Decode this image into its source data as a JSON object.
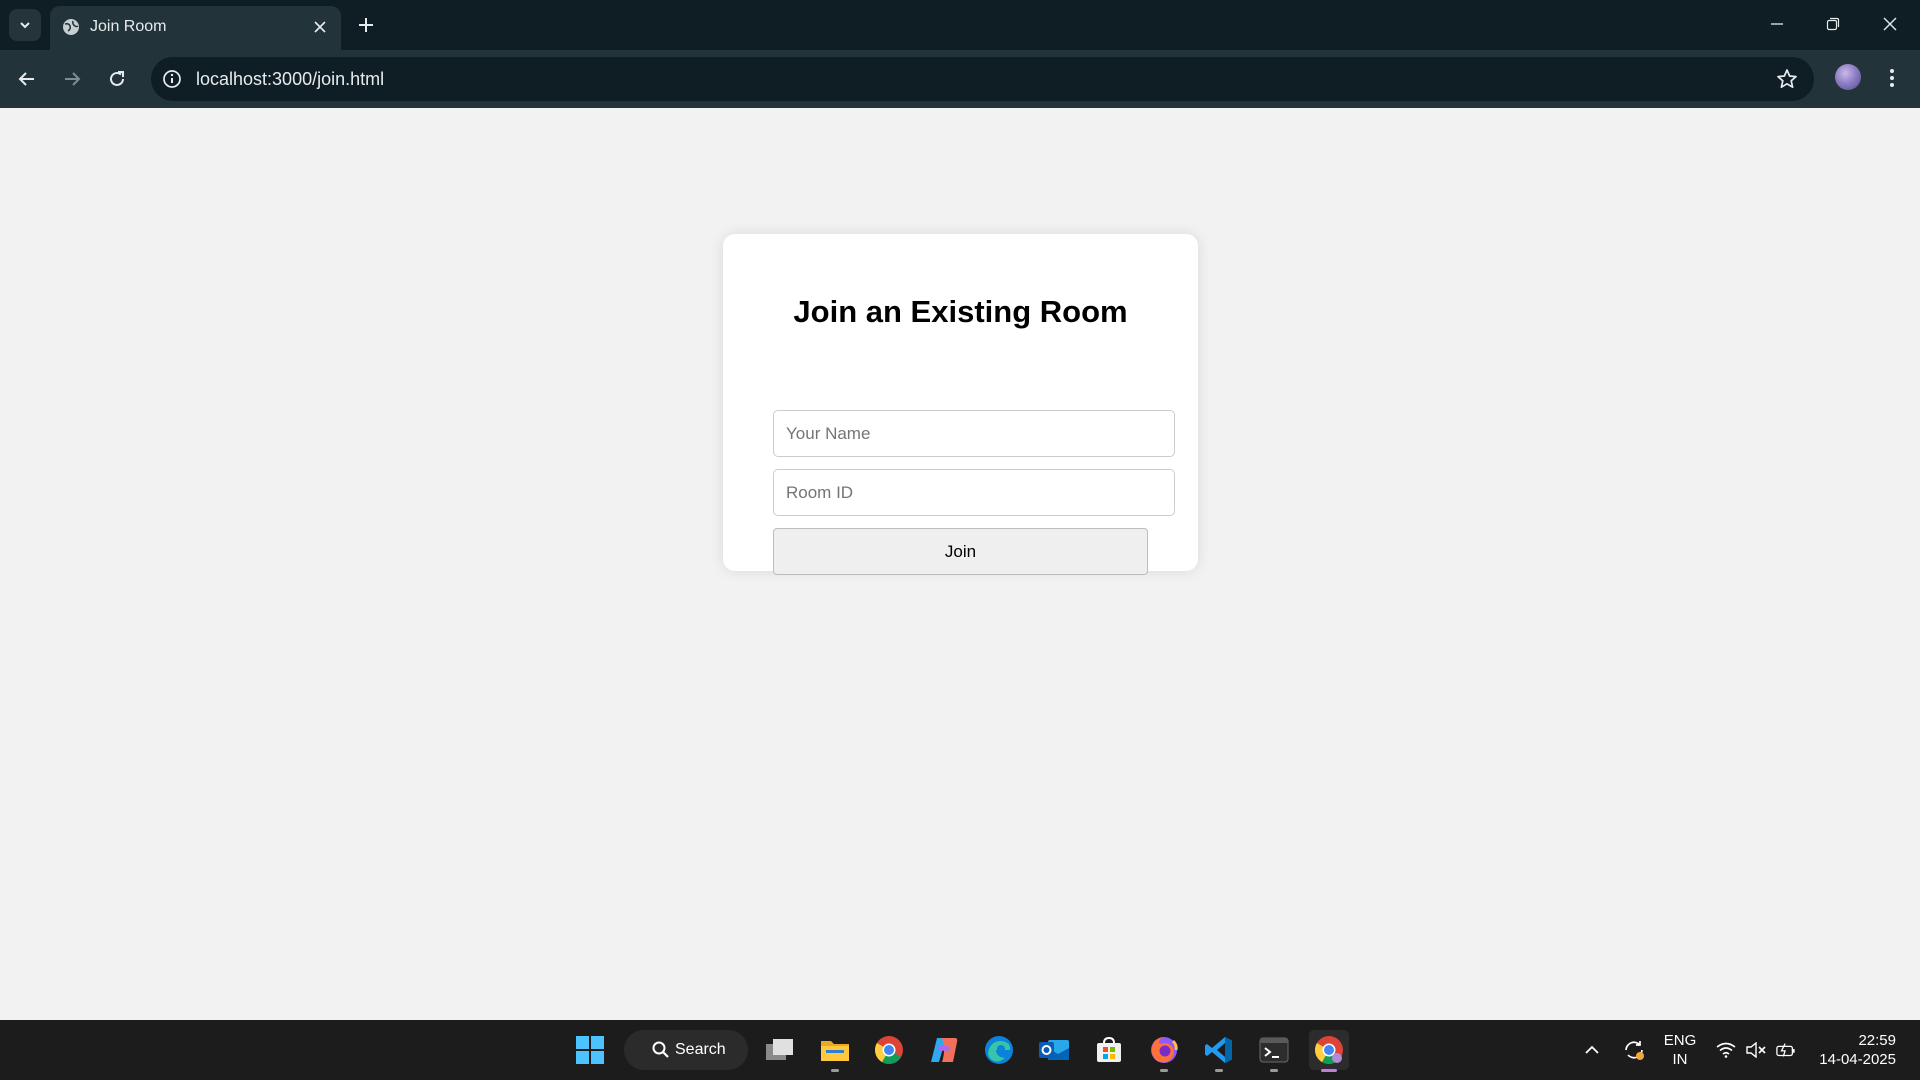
{
  "browser": {
    "tab": {
      "title": "Join Room",
      "favicon": "globe-icon"
    },
    "address_bar": {
      "url": "localhost:3000/join.html"
    },
    "icons": [
      "tab-search-chevron-icon",
      "close-icon",
      "plus-icon",
      "back-arrow-icon",
      "forward-arrow-icon",
      "reload-icon",
      "info-icon",
      "star-icon",
      "kebab-menu-icon",
      "minimize-icon",
      "restore-icon"
    ]
  },
  "page": {
    "title": "Join an Existing Room",
    "name_field": {
      "placeholder": "Your Name",
      "value": ""
    },
    "room_field": {
      "placeholder": "Room ID",
      "value": ""
    },
    "join_button": "Join"
  },
  "taskbar": {
    "search_label": "Search",
    "apps": [
      "windows-start",
      "task-view",
      "file-explorer",
      "chrome",
      "copilot",
      "edge",
      "outlook",
      "microsoft-store",
      "firefox",
      "vscode",
      "terminal",
      "chrome-active"
    ],
    "tray": {
      "language": "ENG",
      "region": "IN",
      "time": "22:59",
      "date": "14-04-2025"
    }
  },
  "colors": {
    "tabstrip_bg": "#0f1e24",
    "toolbar_bg": "#223339",
    "page_bg": "#f2f2f2",
    "card_bg": "#ffffff",
    "taskbar_bg": "#1c1c1c",
    "active_indicator": "#c37be0"
  }
}
